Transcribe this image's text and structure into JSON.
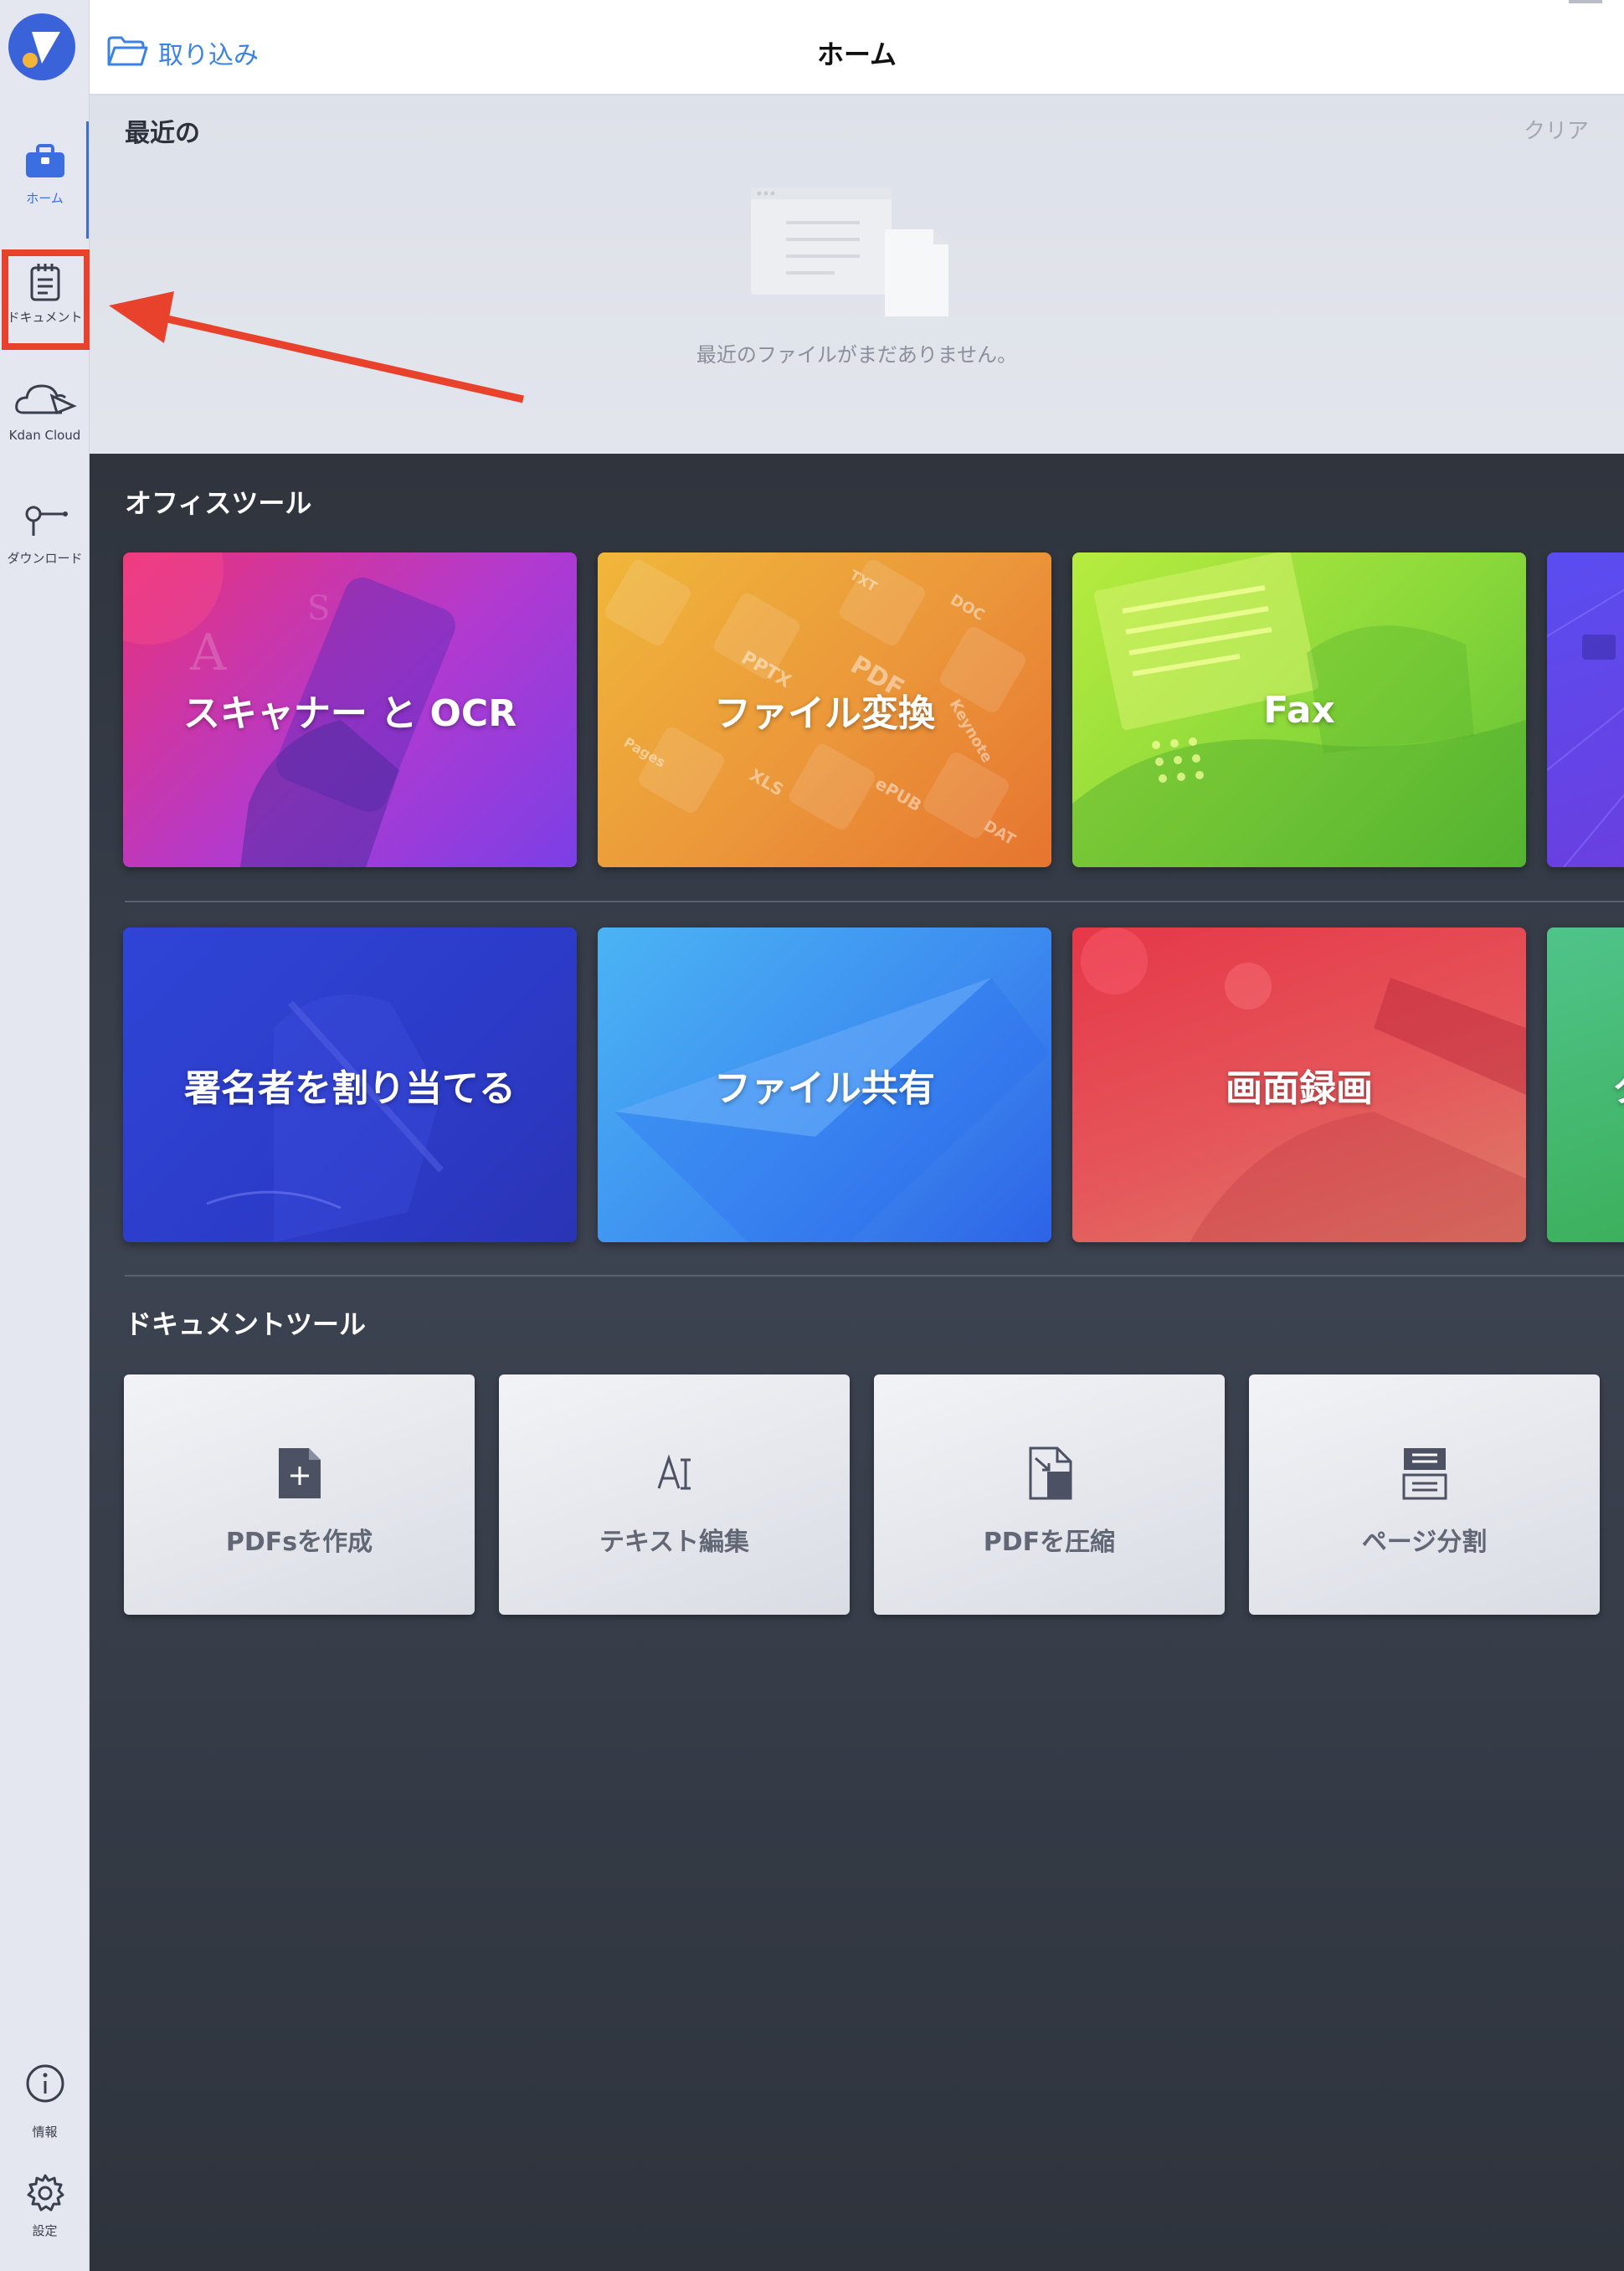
{
  "sidebar": {
    "items": [
      {
        "label": "ホーム",
        "icon": "toolbox-icon"
      },
      {
        "label": "ドキュメント",
        "icon": "document-icon"
      },
      {
        "label": "Kdan Cloud",
        "icon": "cloud-icon"
      },
      {
        "label": "ダウンロード",
        "icon": "download-icon"
      }
    ],
    "bottom": [
      {
        "label": "情報",
        "icon": "info-icon"
      },
      {
        "label": "設定",
        "icon": "gear-icon"
      }
    ]
  },
  "header": {
    "import_label": "取り込み",
    "title": "ホーム"
  },
  "recent": {
    "title": "最近の",
    "clear_label": "クリア",
    "empty_message": "最近のファイルがまだありません。"
  },
  "office_tools": {
    "title": "オフィスツール",
    "row1": [
      "スキャナー と OCR",
      "ファイル変換",
      "Fax"
    ],
    "row2": [
      "署名者を割り当てる",
      "ファイル共有",
      "画面録画",
      "タ"
    ]
  },
  "document_tools": {
    "title": "ドキュメントツール",
    "items": [
      "PDFsを作成",
      "テキスト編集",
      "PDFを圧縮",
      "ページ分割"
    ]
  },
  "conversion_tags": [
    "PPTX",
    "PDF",
    "XLS",
    "ePUB",
    "DOC",
    "Keynote",
    "Pages",
    "DAT",
    "TXT"
  ],
  "colors": {
    "accent": "#3b6ee0",
    "highlight": "#e8412c"
  }
}
